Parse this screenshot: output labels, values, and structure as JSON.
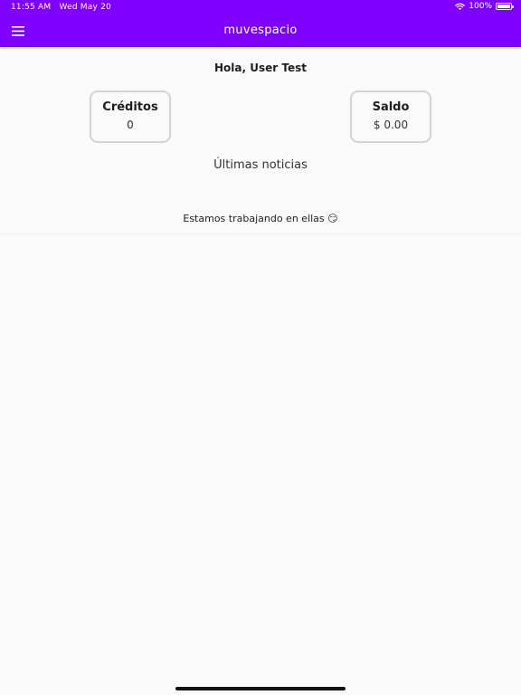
{
  "status_bar": {
    "time": "11:55 AM",
    "date": "Wed May 20",
    "battery": "100%",
    "battery_level": 1.0
  },
  "app_bar": {
    "title": "muvespacio",
    "menu_icon": "hamburger-menu-icon",
    "background_color": "#8000ff"
  },
  "greeting": "Hola, User Test",
  "cards": {
    "creditos": {
      "title": "Créditos",
      "value": "0"
    },
    "saldo": {
      "title": "Saldo",
      "value": "$ 0.00"
    }
  },
  "news": {
    "title": "Últimas noticias",
    "empty_message": "Estamos trabajando en ellas 😏"
  }
}
